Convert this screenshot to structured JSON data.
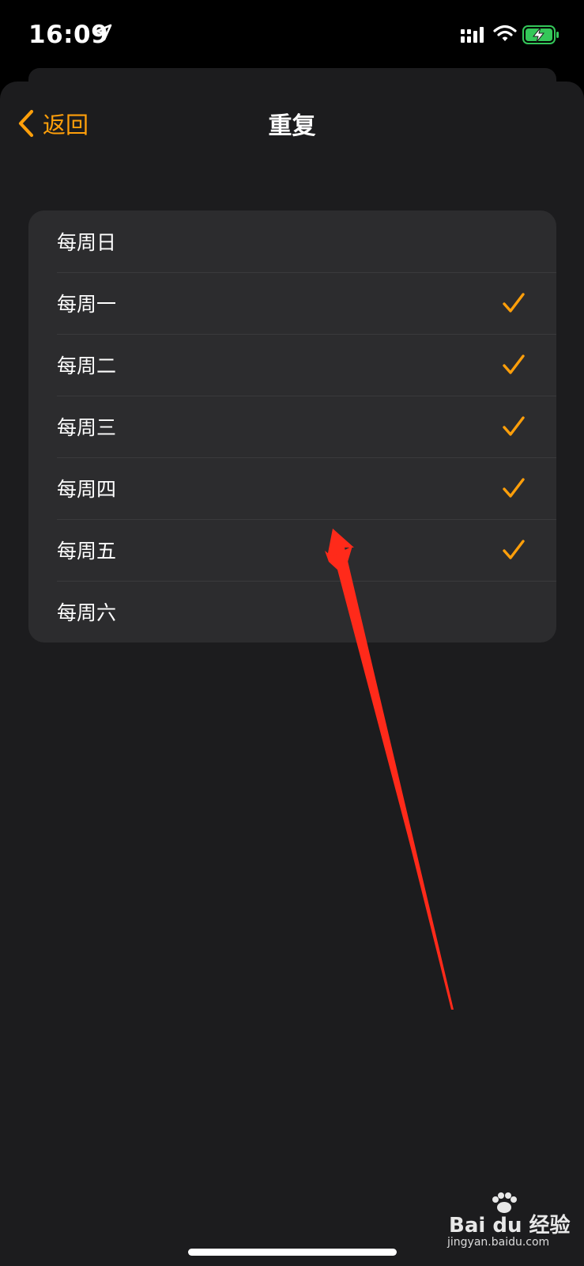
{
  "status_bar": {
    "time": "16:09"
  },
  "nav": {
    "back_label": "返回",
    "title": "重复"
  },
  "days": [
    {
      "label": "每周日",
      "checked": false
    },
    {
      "label": "每周一",
      "checked": true
    },
    {
      "label": "每周二",
      "checked": true
    },
    {
      "label": "每周三",
      "checked": true
    },
    {
      "label": "每周四",
      "checked": true
    },
    {
      "label": "每周五",
      "checked": true
    },
    {
      "label": "每周六",
      "checked": false
    }
  ],
  "colors": {
    "accent": "#ff9f0a",
    "annotation_arrow": "#ff2a1a",
    "battery": "#34c759"
  },
  "watermark": {
    "brand": "Bai du 经验",
    "url": "jingyan.baidu.com"
  }
}
